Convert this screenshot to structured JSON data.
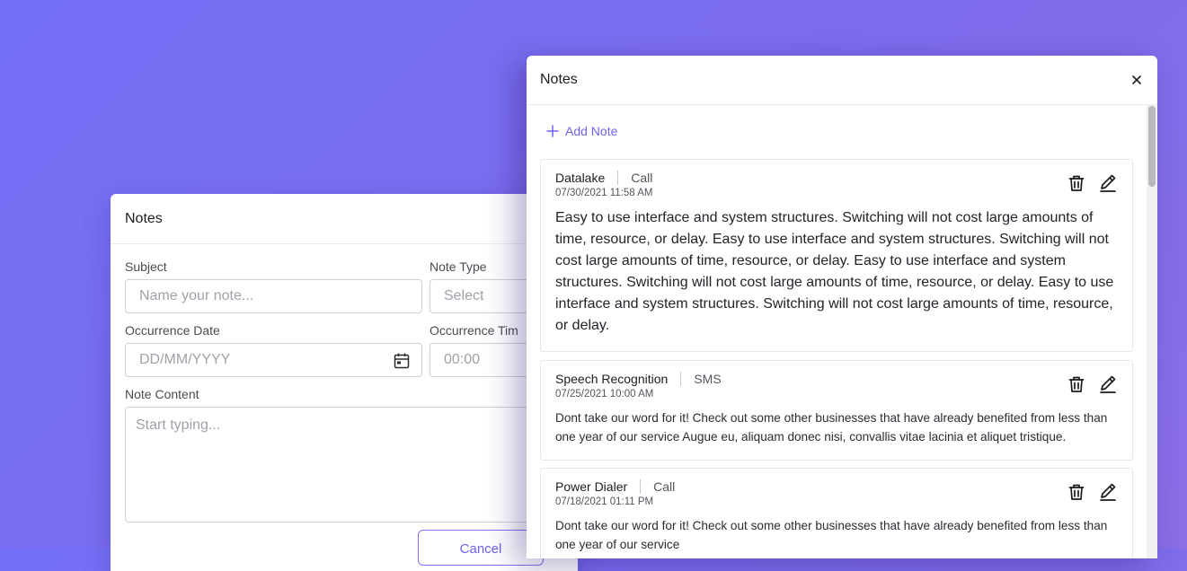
{
  "form_panel": {
    "title": "Notes",
    "subject_label": "Subject",
    "subject_placeholder": "Name your note...",
    "note_type_label": "Note Type",
    "note_type_placeholder": "Select",
    "date_label": "Occurrence Date",
    "date_placeholder": "DD/MM/YYYY",
    "time_label": "Occurrence Tim",
    "time_placeholder": "00:00",
    "content_label": "Note Content",
    "content_placeholder": "Start typing...",
    "cancel_label": "Cancel"
  },
  "list_panel": {
    "title": "Notes",
    "close_icon": "close-icon",
    "add_note_label": "Add Note",
    "notes": [
      {
        "subject": "Datalake",
        "type": "Call",
        "date": "07/30/2021 11:58 AM",
        "content": "Easy to use interface and system structures. Switching will not cost large amounts of time, resource, or delay. Easy to use interface and system structures. Switching will not cost large amounts of time, resource, or delay. Easy to use interface and system structures. Switching will not cost large amounts of time, resource, or delay. Easy to use interface and system structures. Switching will not cost large amounts of time, resource, or delay."
      },
      {
        "subject": "Speech Recognition",
        "type": "SMS",
        "date": "07/25/2021 10:00 AM",
        "content": "Dont take our word for it! Check out some other businesses that have already benefited from less than one year of our service Augue eu, aliquam donec nisi, convallis vitae lacinia et aliquet tristique."
      },
      {
        "subject": "Power Dialer",
        "type": "Call",
        "date": "07/18/2021 01:11 PM",
        "content": "Dont take our word for it! Check out some other businesses that have already benefited from less than one year of our service"
      }
    ]
  },
  "colors": {
    "accent": "#6b63ee",
    "background_start": "#7470f7",
    "background_end": "#8b6ee6"
  }
}
